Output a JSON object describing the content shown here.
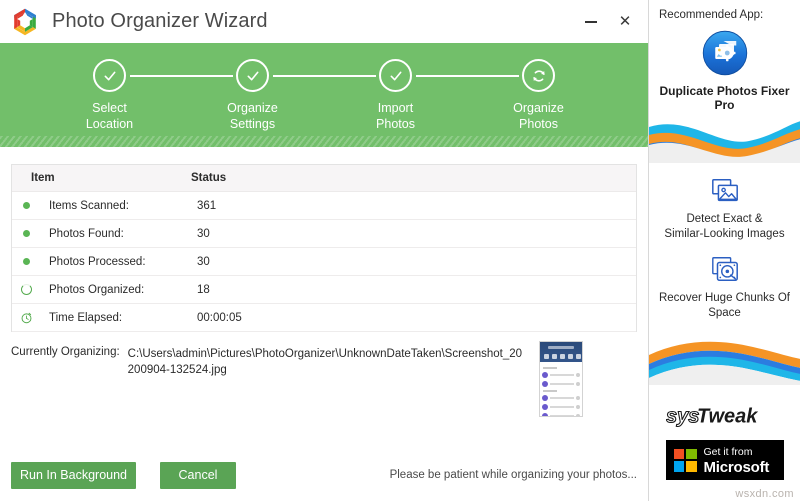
{
  "window": {
    "title": "Photo Organizer Wizard",
    "logo_name": "systweak-hexagon-logo",
    "minimize_label": "–",
    "close_label": "✕"
  },
  "stepper": {
    "accent_color": "#72bf6a",
    "steps": [
      {
        "label": "Select\nLocation",
        "icon": "check-icon",
        "state": "complete"
      },
      {
        "label": "Organize\nSettings",
        "icon": "check-icon",
        "state": "complete"
      },
      {
        "label": "Import\nPhotos",
        "icon": "check-icon",
        "state": "complete"
      },
      {
        "label": "Organize\nPhotos",
        "icon": "refresh-icon",
        "state": "active"
      }
    ]
  },
  "table": {
    "columns": [
      "Item",
      "Status"
    ],
    "rows": [
      {
        "icon": "green-dot-icon",
        "item": "Items Scanned:",
        "status": "361"
      },
      {
        "icon": "green-dot-icon",
        "item": "Photos Found:",
        "status": "30"
      },
      {
        "icon": "green-dot-icon",
        "item": "Photos Processed:",
        "status": "30"
      },
      {
        "icon": "spinner-ring-icon",
        "item": "Photos Organized:",
        "status": "18"
      },
      {
        "icon": "stopwatch-icon",
        "item": "Time Elapsed:",
        "status": "00:00:05"
      }
    ]
  },
  "current": {
    "label": "Currently Organizing:",
    "path": "C:\\Users\\admin\\Pictures\\PhotoOrganizer\\UnknownDateTaken\\Screenshot_20200904-132524.jpg",
    "thumbnail_name": "current-photo-thumbnail"
  },
  "footer": {
    "run_background_label": "Run In Background",
    "cancel_label": "Cancel",
    "note": "Please be patient while organizing your photos...",
    "button_color": "#5aa455"
  },
  "sidebar": {
    "heading": "Recommended App:",
    "app_name": "Duplicate Photos Fixer Pro",
    "app_icon": "duplicate-photos-fixer-icon",
    "features": [
      {
        "icon": "images-stack-icon",
        "text": "Detect Exact &\nSimilar-Looking Images"
      },
      {
        "icon": "hard-drive-icon",
        "text": "Recover Huge Chunks Of\nSpace"
      }
    ],
    "brand": "systweak",
    "store_badge": {
      "line1": "Get it from",
      "line2": "Microsoft"
    }
  },
  "watermark": "wsxdn.com"
}
